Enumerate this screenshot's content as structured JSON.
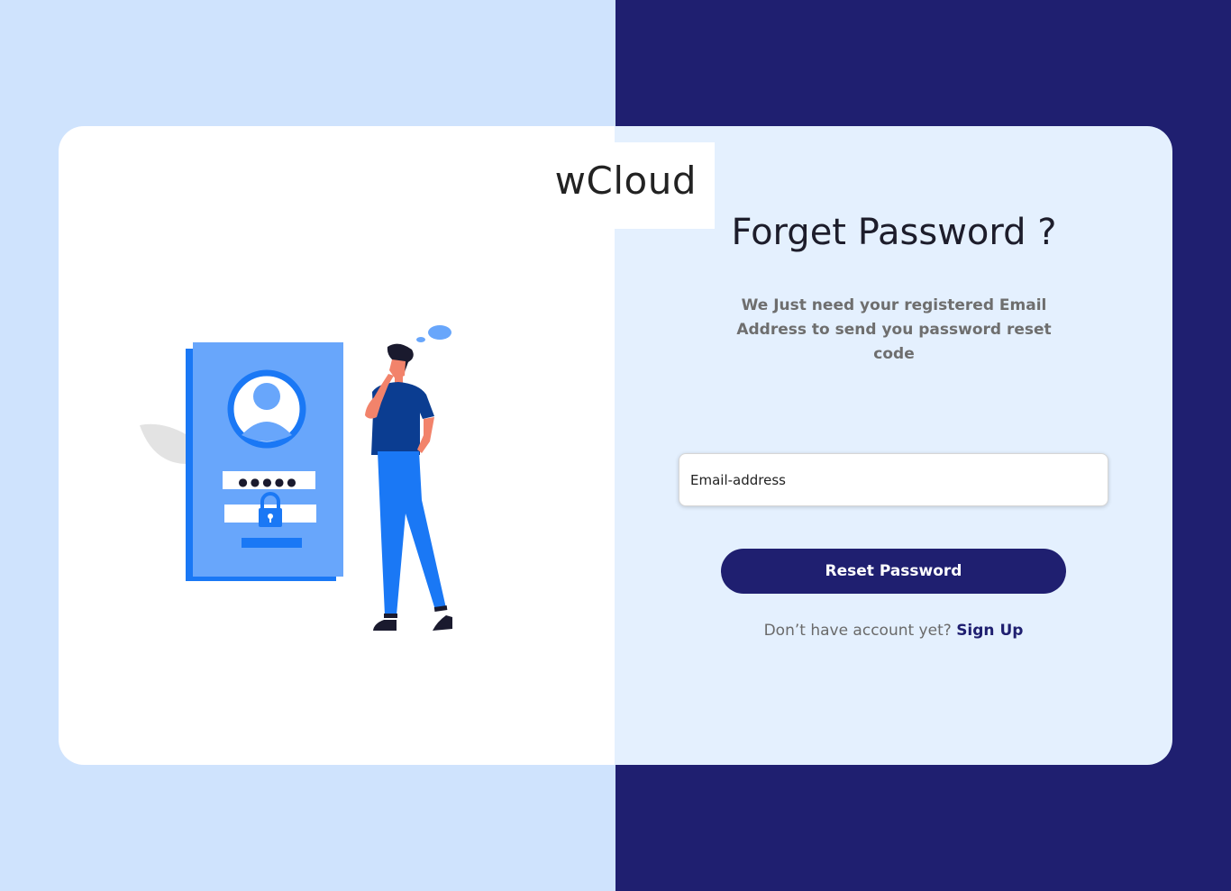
{
  "brand": {
    "name": "wCloud"
  },
  "form": {
    "title": "Forget Password ?",
    "subtitle": "We Just need your registered Email Address to send you password reset code",
    "email_placeholder": "Email-address",
    "reset_label": "Reset Password"
  },
  "signup": {
    "prompt": "Don’t have account yet?",
    "link_label": "Sign Up"
  },
  "illustration": {
    "icon_name": "forgot-password-illustration",
    "password_mask": "●●●●●"
  },
  "colors": {
    "navy": "#1f1f70",
    "light_blue": "#cfe3fd",
    "panel_blue": "#e4f0fe",
    "accent_blue": "#2f80ed"
  }
}
